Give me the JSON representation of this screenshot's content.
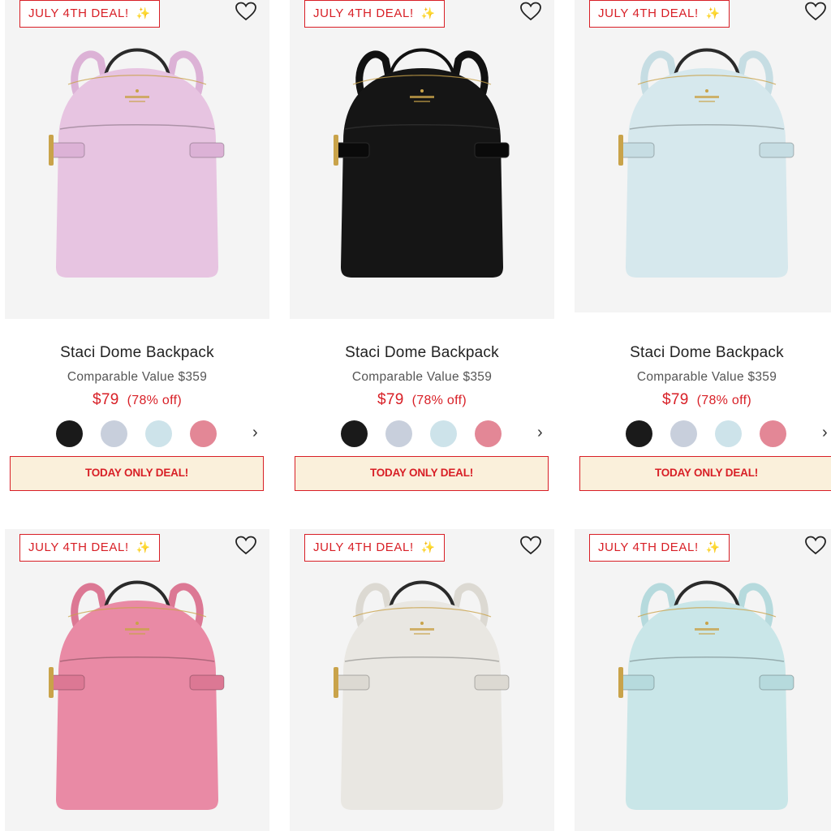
{
  "colors": {
    "accent": "#d81f26",
    "deal_background": "#faf0db",
    "image_background": "#f4f4f4"
  },
  "products": [
    {
      "badge": "JULY 4TH DEAL! ",
      "badge_icon": "sparkles-icon",
      "name": "Staci Dome Backpack",
      "comparable": "Comparable Value $359",
      "price": "$79",
      "discount": "(78% off)",
      "bag_color": "#e7c4e1",
      "bag_shade": "#dcb2d6",
      "swatches": [
        {
          "name": "black",
          "color": "#1a1a1a"
        },
        {
          "name": "gray-blue",
          "color": "#c8cfdc"
        },
        {
          "name": "light-blue",
          "color": "#cde3ea"
        },
        {
          "name": "pink",
          "color": "#e38796"
        }
      ],
      "deal_label": "TODAY ONLY DEAL!"
    },
    {
      "badge": "JULY 4TH DEAL! ",
      "badge_icon": "sparkles-icon",
      "name": "Staci Dome Backpack",
      "comparable": "Comparable Value $359",
      "price": "$79",
      "discount": "(78% off)",
      "bag_color": "#151515",
      "bag_shade": "#0a0a0a",
      "swatches": [
        {
          "name": "black",
          "color": "#1a1a1a"
        },
        {
          "name": "gray-blue",
          "color": "#c8cfdc"
        },
        {
          "name": "light-blue",
          "color": "#cde3ea"
        },
        {
          "name": "pink",
          "color": "#e38796"
        }
      ],
      "deal_label": "TODAY ONLY DEAL!"
    },
    {
      "badge": "JULY 4TH DEAL! ",
      "badge_icon": "sparkles-icon",
      "name": "Staci Dome Backpack",
      "comparable": "Comparable Value $359",
      "price": "$79",
      "discount": "(78% off)",
      "bag_color": "#d6e8ed",
      "bag_shade": "#c6dde3",
      "swatches": [
        {
          "name": "black",
          "color": "#1a1a1a"
        },
        {
          "name": "gray-blue",
          "color": "#c8cfdc"
        },
        {
          "name": "light-blue",
          "color": "#cde3ea"
        },
        {
          "name": "pink",
          "color": "#e38796"
        }
      ],
      "deal_label": "TODAY ONLY DEAL!"
    },
    {
      "badge": "JULY 4TH DEAL! ",
      "badge_icon": "sparkles-icon",
      "bag_color": "#e98aa5",
      "bag_shade": "#dc7894"
    },
    {
      "badge": "JULY 4TH DEAL! ",
      "badge_icon": "sparkles-icon",
      "bag_color": "#e9e7e2",
      "bag_shade": "#dcd9d2"
    },
    {
      "badge": "JULY 4TH DEAL! ",
      "badge_icon": "sparkles-icon",
      "bag_color": "#c9e6e8",
      "bag_shade": "#b6dadd"
    }
  ]
}
